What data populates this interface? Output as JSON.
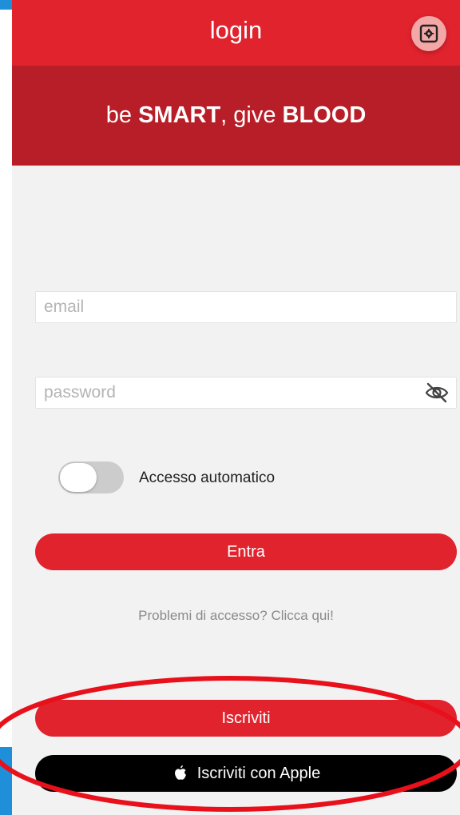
{
  "header": {
    "title": "login",
    "settings_icon": "gear-icon"
  },
  "banner": {
    "tagline_prefix": "be ",
    "tagline_strong1": "SMART",
    "tagline_mid": ", give ",
    "tagline_strong2": "BLOOD"
  },
  "form": {
    "email_placeholder": "email",
    "email_value": "",
    "password_placeholder": "password",
    "password_value": "",
    "password_toggle_icon": "eye-off-icon",
    "auto_login_label": "Accesso automatico",
    "auto_login_enabled": false
  },
  "actions": {
    "login_label": "Entra",
    "help_link": "Problemi di accesso? Clicca qui!",
    "register_label": "Iscriviti",
    "apple_register_label": "Iscriviti con Apple"
  },
  "colors": {
    "header_red": "#e1232e",
    "banner_red": "#b81e27",
    "apple_black": "#000000",
    "annotation_red": "#e8101a",
    "frame_blue": "#1e8fd8"
  }
}
